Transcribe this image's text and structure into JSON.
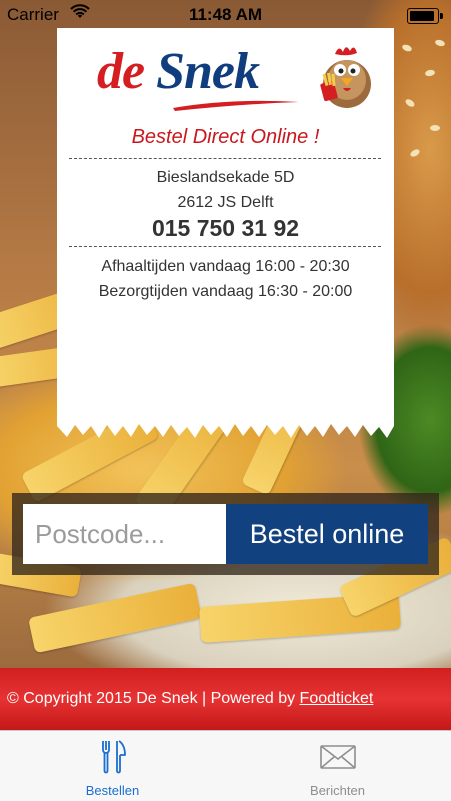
{
  "status_bar": {
    "carrier": "Carrier",
    "time": "11:48 AM",
    "wifi_icon": "wifi-icon",
    "battery_icon": "battery-icon"
  },
  "header": {
    "logo_de": "de",
    "logo_snek": "Snek",
    "slogan": "Bestel Direct Online !"
  },
  "address": {
    "street": "Bieslandsekade 5D",
    "city": "2612 JS Delft",
    "phone": "015 750 31 92"
  },
  "hours": {
    "pickup": "Afhaaltijden vandaag 16:00 - 20:30",
    "delivery": "Bezorgtijden vandaag 16:30 - 20:00"
  },
  "order": {
    "postcode_placeholder": "Postcode...",
    "postcode_value": "",
    "button_label": "Bestel online"
  },
  "footer": {
    "copyright": "© Copyright 2015 De Snek | Powered by ",
    "link_text": "Foodticket"
  },
  "tabs": [
    {
      "label": "Bestellen",
      "icon": "fork-knife-icon",
      "active": true
    },
    {
      "label": "Berichten",
      "icon": "envelope-icon",
      "active": false
    }
  ],
  "colors": {
    "brand_red": "#d41e22",
    "brand_blue": "#0f3d7d",
    "button_blue": "#11427f",
    "tab_active": "#1a6fd1",
    "footer_red": "#d21f1f"
  }
}
